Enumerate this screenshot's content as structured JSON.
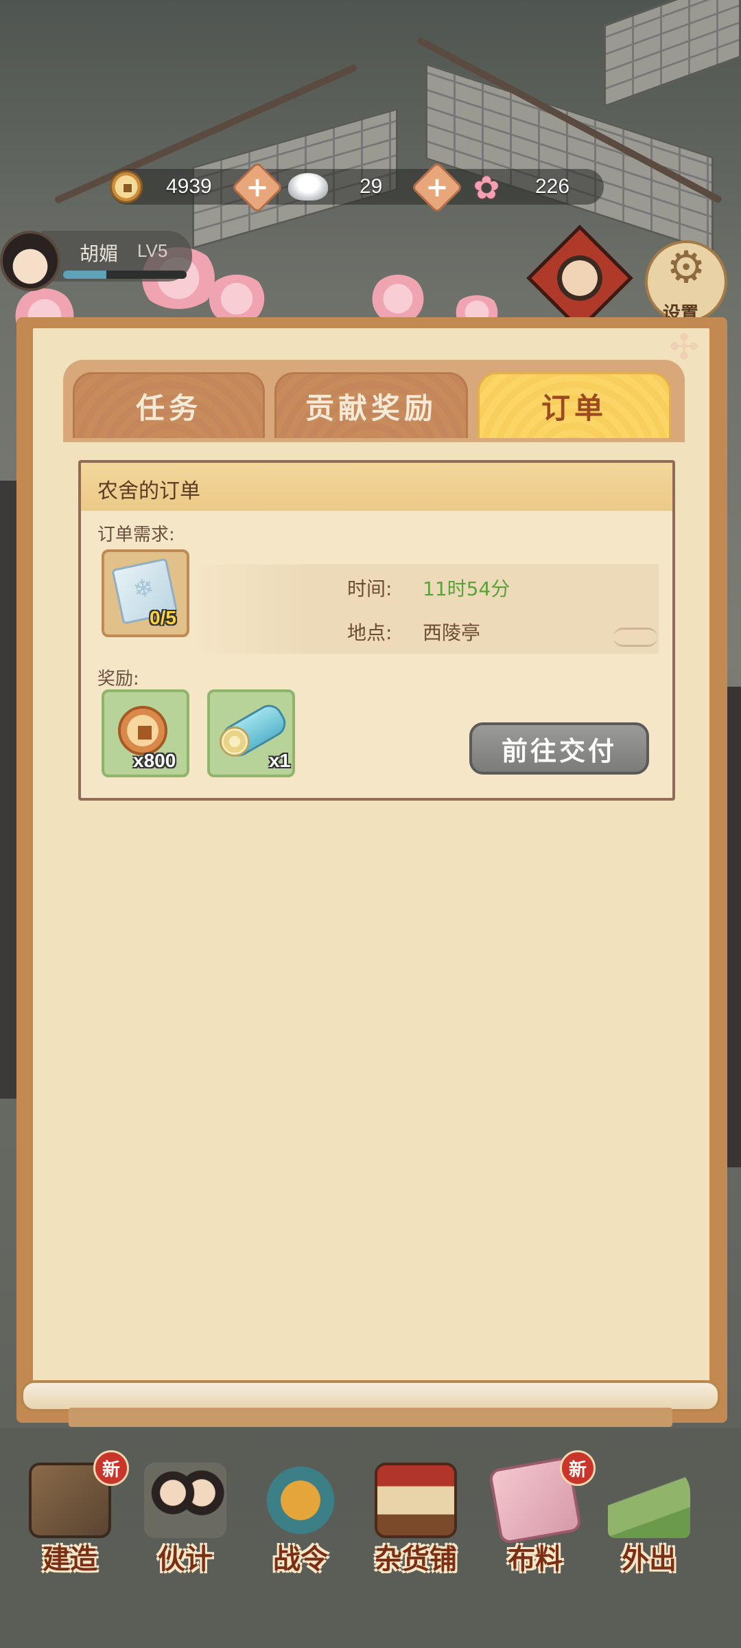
{
  "currency": {
    "copper": "4939",
    "silver": "29",
    "blossom": "226"
  },
  "player": {
    "name": "胡媚",
    "level": "LV5",
    "xp_fraction": 0.35
  },
  "settings": {
    "label": "设置"
  },
  "tabs": [
    {
      "label": "任务",
      "active": false
    },
    {
      "label": "贡献奖励",
      "active": false
    },
    {
      "label": "订单",
      "active": true
    }
  ],
  "order": {
    "title": "农舍的订单",
    "requirement_label": "订单需求:",
    "requirement_item": {
      "icon": "cloth-icon",
      "progress": "0/5"
    },
    "time_label": "时间:",
    "time_value": "11时54分",
    "location_label": "地点:",
    "location_value": "西陵亭",
    "reward_label": "奖励:",
    "rewards": [
      {
        "icon": "copper-coin-icon",
        "qty": "x800"
      },
      {
        "icon": "log-icon",
        "qty": "x1"
      }
    ],
    "deliver_button": "前往交付"
  },
  "bottom_nav": [
    {
      "label": "建造",
      "badge": "新"
    },
    {
      "label": "伙计",
      "badge": ""
    },
    {
      "label": "战令",
      "badge": ""
    },
    {
      "label": "杂货铺",
      "badge": ""
    },
    {
      "label": "布料",
      "badge": "新"
    },
    {
      "label": "外出",
      "badge": ""
    }
  ],
  "colors": {
    "active_tab": "#f8cf5c",
    "inactive_tab": "#c4865a",
    "time_value": "#5aa23a",
    "panel": "#f2e1bd"
  }
}
